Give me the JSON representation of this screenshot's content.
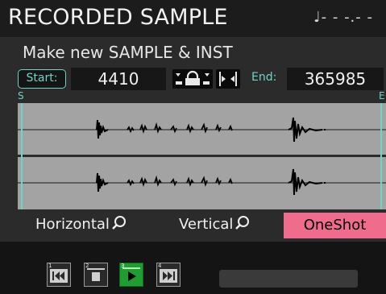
{
  "header": {
    "title": "RECORDED SAMPLE",
    "tempo": "♩- - -.- -"
  },
  "subtitle": "Make new SAMPLE & INST",
  "range": {
    "start_label": "Start:",
    "start_value": "4410",
    "end_label": "End:",
    "end_value": "365985",
    "start_marker": "S",
    "end_marker": "E"
  },
  "icons": {
    "lock": "lock-icon",
    "snap": "snap-markers-icon",
    "zoom": "magnifier-icon",
    "transport": [
      "skip-to-start-icon",
      "stop-icon",
      "play-icon",
      "fast-forward-icon"
    ]
  },
  "modes": {
    "horizontal": "Horizontal",
    "vertical": "Vertical",
    "oneshot": "OneShot"
  },
  "transport": {
    "numbers": [
      "1",
      "2",
      "3",
      "4"
    ]
  },
  "colors": {
    "accent": "#6fd3c5",
    "oneshot_bg": "#f06c8d",
    "play_active": "#1f9c32",
    "waveform_bg": "#a3a3a3"
  }
}
